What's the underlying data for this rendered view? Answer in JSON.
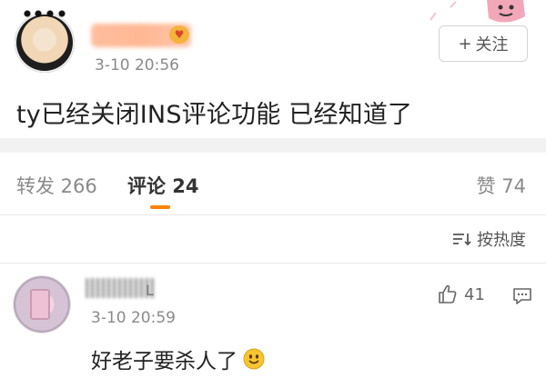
{
  "post": {
    "time": "3-10 20:56",
    "text": "ty已经关闭INS评论功能 已经知道了",
    "follow_label": "关注"
  },
  "tabs": {
    "repost_label": "转发 266",
    "comments_label": "评论 24",
    "likes_label": "赞 74",
    "sort_label": "按热度"
  },
  "comment": {
    "user_visible": "L",
    "time": "3-10 20:59",
    "text": "好老子要杀人了",
    "like_count": "41"
  },
  "icons": {
    "follow": "plus-icon",
    "sort": "sort-icon",
    "like": "thumbs-up-icon",
    "reply": "comment-icon",
    "emoji": "smiley-emoji",
    "sticker": "cartoon-sticker",
    "badge": "vip-badge-icon"
  },
  "colors": {
    "accent": "#ff8200",
    "text": "#222222",
    "muted": "#8a8a8a"
  }
}
